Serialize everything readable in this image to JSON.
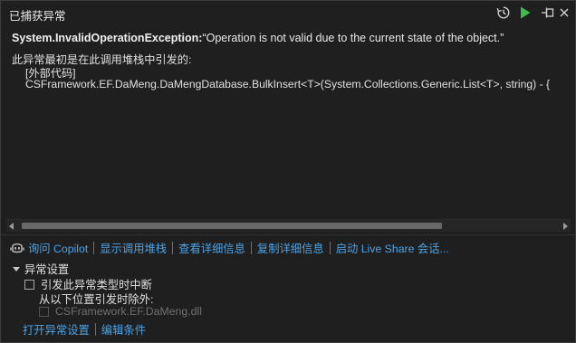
{
  "window": {
    "title": "已捕获异常"
  },
  "exception": {
    "type": "System.InvalidOperationException:",
    "message": "“Operation is not valid due to the current state of the object.”"
  },
  "stack": {
    "intro": "此异常最初是在此调用堆栈中引发的:",
    "frames": [
      "[外部代码]",
      "CSFramework.EF.DaMeng.DaMengDatabase.BulkInsert<T>(System.Collections.Generic.List<T>, string) - {"
    ]
  },
  "actions": {
    "ask_copilot": "询问 Copilot",
    "show_call_stack": "显示调用堆栈",
    "view_details": "查看详细信息",
    "copy_details": "复制详细信息",
    "live_share": "启动 Live Share 会话..."
  },
  "settings": {
    "header": "异常设置",
    "break_when_thrown": "引发此异常类型时中断",
    "except_when_from": "从以下位置引发时除外:",
    "module": "CSFramework.EF.DaMeng.dll",
    "open_settings": "打开异常设置",
    "edit_conditions": "编辑条件"
  },
  "colors": {
    "background": "#1f1f1f",
    "link": "#4aa3e8",
    "continue_green": "#3fb950"
  },
  "icons": {
    "history": "history-icon",
    "continue": "continue-icon",
    "pin": "pin-icon",
    "close": "close-icon",
    "copilot": "copilot-icon"
  }
}
